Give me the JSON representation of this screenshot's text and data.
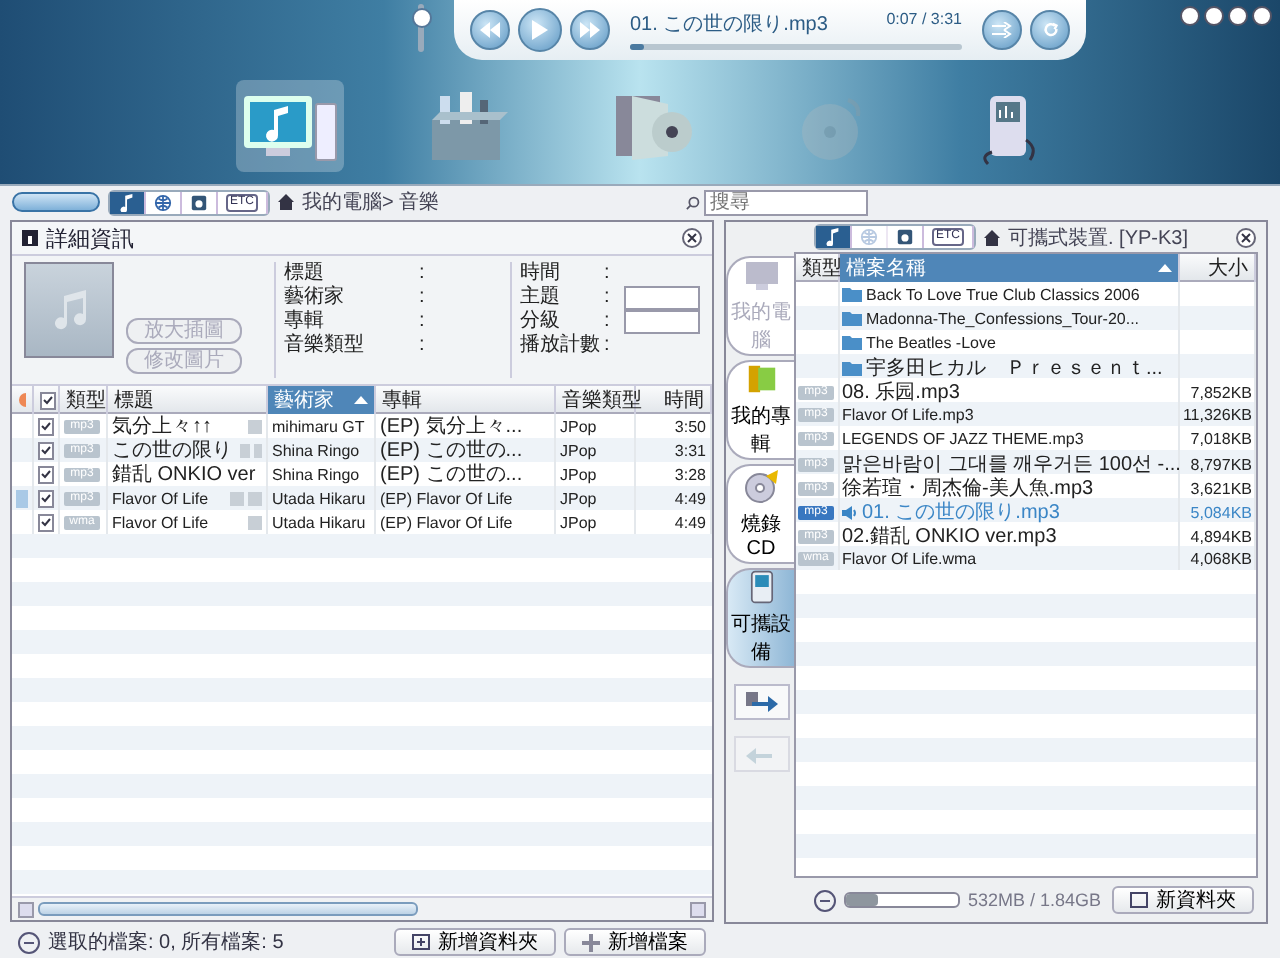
{
  "player": {
    "track": "01. この世の限り.mp3",
    "time": "0:07 / 3:31",
    "level": 0.04,
    "volume": {
      "level": 0.85
    }
  },
  "nav": [
    {
      "kind": "computer",
      "selected": true,
      "disabled": false
    },
    {
      "kind": "toolbox",
      "selected": false,
      "disabled": false
    },
    {
      "kind": "album",
      "selected": false,
      "disabled": false
    },
    {
      "kind": "disc",
      "selected": false,
      "disabled": true
    },
    {
      "kind": "player",
      "selected": false,
      "disabled": false
    }
  ],
  "library": {
    "tabs": [
      {
        "kind": "music",
        "selected": true
      },
      {
        "kind": "globe",
        "selected": false
      },
      {
        "kind": "photo",
        "selected": false
      },
      {
        "kind": "etc",
        "label": "ETC",
        "selected": false
      }
    ],
    "breadcrumb": "我的電腦> 音樂",
    "search": {
      "placeholder": "搜尋"
    },
    "details": {
      "title": "詳細資訊",
      "buttons": [
        {
          "label": "放大插圖",
          "disabled": true
        },
        {
          "label": "修改圖片",
          "disabled": true
        }
      ],
      "fields_left": [
        {
          "label": "標題",
          "colon": ":"
        },
        {
          "label": "藝術家",
          "colon": ":"
        },
        {
          "label": "專輯",
          "colon": ":"
        },
        {
          "label": "音樂類型",
          "colon": ":"
        }
      ],
      "fields_right": [
        {
          "label": "時間",
          "colon": ":",
          "input": false
        },
        {
          "label": "主題",
          "colon": ":",
          "input": true
        },
        {
          "label": "分級",
          "colon": ":",
          "input": true
        },
        {
          "label": "播放計數",
          "colon": ":",
          "input": false
        }
      ]
    },
    "table": {
      "select_all": {
        "checked": true
      },
      "columns": [
        {
          "label": "類型",
          "sorted": false
        },
        {
          "label": "標題",
          "sorted": false
        },
        {
          "label": "藝術家",
          "sorted": true
        },
        {
          "label": "專輯",
          "sorted": false
        },
        {
          "label": "音樂類型",
          "sorted": false
        },
        {
          "label": "時間",
          "sorted": false
        }
      ],
      "rows": [
        {
          "selected": false,
          "checked": true,
          "type": "mp3",
          "title": "気分上々↑↑",
          "lyrics": false,
          "artist": "mihimaru GT",
          "album": "(EP) 気分上々...",
          "genre": "JPop",
          "time": "3:50"
        },
        {
          "selected": false,
          "checked": true,
          "type": "mp3",
          "title": "この世の限り",
          "lyrics": true,
          "artist": "Shina Ringo",
          "album": "(EP) この世の...",
          "genre": "JPop",
          "time": "3:31"
        },
        {
          "selected": false,
          "checked": true,
          "type": "mp3",
          "title": "錯乱 ONKIO ver",
          "lyrics": false,
          "artist": "Shina Ringo",
          "album": "(EP) この世の...",
          "genre": "JPop",
          "time": "3:28"
        },
        {
          "selected": true,
          "checked": true,
          "type": "mp3",
          "title": "Flavor Of Life",
          "lyrics": true,
          "artist": "Utada Hikaru",
          "album": "(EP) Flavor Of Life",
          "genre": "JPop",
          "time": "4:49"
        },
        {
          "selected": false,
          "checked": true,
          "type": "wma",
          "title": "Flavor Of Life",
          "lyrics": false,
          "artist": "Utada Hikaru",
          "album": "(EP) Flavor Of Life",
          "genre": "JPop",
          "time": "4:49"
        }
      ]
    },
    "status": "選取的檔案: 0, 所有檔案: 5",
    "buttons": [
      {
        "kind": "folder",
        "label": "新增資料夾"
      },
      {
        "kind": "add",
        "label": "新增檔案"
      }
    ]
  },
  "device": {
    "tabs": [
      {
        "kind": "music",
        "selected": true,
        "disabled": false
      },
      {
        "kind": "globe",
        "selected": false,
        "disabled": true
      },
      {
        "kind": "photo",
        "selected": false,
        "disabled": false
      },
      {
        "kind": "etc",
        "label": "ETC",
        "selected": false,
        "disabled": false
      }
    ],
    "breadcrumb": "可攜式裝置. [YP-K3]",
    "side_tabs": [
      {
        "kind": "computer",
        "label": "我的電腦",
        "selected": false,
        "disabled": true
      },
      {
        "kind": "album",
        "label": "我的專輯",
        "selected": false,
        "disabled": false
      },
      {
        "kind": "cd",
        "label": "燒錄CD",
        "selected": false,
        "disabled": false
      },
      {
        "kind": "player",
        "label": "可攜設備",
        "selected": true,
        "disabled": false
      }
    ],
    "transfer": [
      {
        "kind": "send",
        "disabled": false
      },
      {
        "kind": "receive",
        "disabled": true
      }
    ],
    "table": {
      "columns": [
        {
          "label": "類型",
          "sorted": false
        },
        {
          "label": "檔案名稱",
          "sorted": true
        },
        {
          "label": "大小",
          "sorted": false
        }
      ],
      "rows": [
        {
          "kind": "folder",
          "name": "Back To Love True Club Classics 2006",
          "playing": false
        },
        {
          "kind": "folder",
          "name": "Madonna-The_Confessions_Tour-20...",
          "playing": false
        },
        {
          "kind": "folder",
          "name": "The Beatles  -Love",
          "playing": false
        },
        {
          "kind": "folder",
          "name": "宇多田ヒカル　Ｐｒｅｓｅｎｔ...",
          "playing": false
        },
        {
          "kind": "file",
          "type": "mp3",
          "name": "08. 乐园.mp3",
          "size": "7,852KB",
          "playing": false
        },
        {
          "kind": "file",
          "type": "mp3",
          "name": "Flavor Of Life.mp3",
          "size": "11,326KB",
          "playing": false
        },
        {
          "kind": "file",
          "type": "mp3",
          "name": "LEGENDS OF JAZZ THEME.mp3",
          "size": "7,018KB",
          "playing": false
        },
        {
          "kind": "file",
          "type": "mp3",
          "name": "맑은바람이 그대를 깨우거든 100선 -...",
          "size": "8,797KB",
          "playing": false
        },
        {
          "kind": "file",
          "type": "mp3",
          "name": "徐若瑄・周杰倫-美人魚.mp3",
          "size": "3,621KB",
          "playing": false
        },
        {
          "kind": "file",
          "type": "mp3",
          "name": "01. この世の限り.mp3",
          "size": "5,084KB",
          "playing": true
        },
        {
          "kind": "file",
          "type": "mp3",
          "name": "02.錯乱 ONKIO ver.mp3",
          "size": "4,894KB",
          "playing": false
        },
        {
          "kind": "file",
          "type": "wma",
          "name": "Flavor Of Life.wma",
          "size": "4,068KB",
          "playing": false
        }
      ]
    },
    "storage": {
      "level": 0.28,
      "reading": "532MB / 1.84GB"
    },
    "new_folder": "新資料夾"
  }
}
